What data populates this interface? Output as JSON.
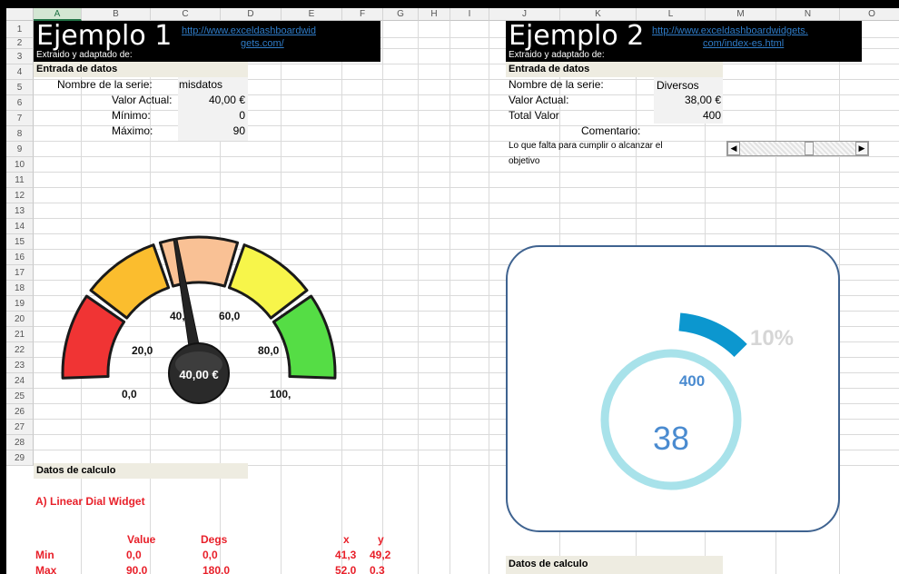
{
  "columns": [
    "A",
    "B",
    "C",
    "D",
    "E",
    "F",
    "G",
    "H",
    "I",
    "J",
    "K",
    "L",
    "M",
    "N",
    "O"
  ],
  "rows": [
    "1",
    "2",
    "3",
    "4",
    "5",
    "6",
    "7",
    "8",
    "9",
    "10",
    "11",
    "12",
    "13",
    "14",
    "15",
    "16",
    "17",
    "18",
    "19",
    "20",
    "21",
    "22",
    "23",
    "24",
    "25",
    "26",
    "27",
    "28",
    "29"
  ],
  "selected_column": "A",
  "example1": {
    "title": "Ejemplo 1",
    "link_line1": "http://www.exceldashboardwid",
    "link_line2": "gets.com/",
    "extracted": "Extraido y adaptado de:",
    "input_header": "Entrada de datos",
    "series_label": "Nombre de la serie:",
    "series_value": "misdatos",
    "actual_label": "Valor Actual:",
    "actual_value": "40,00 €",
    "min_label": "Mínimo:",
    "min_value": "0",
    "max_label": "Máximo:",
    "max_value": "90",
    "calc_header": "Datos de calculo",
    "widget_title": "A) Linear Dial Widget",
    "table_headers": {
      "value": "Value",
      "degs": "Degs",
      "x": "x",
      "y": "y"
    },
    "table_rows": [
      {
        "label": "Min",
        "value": "0,0",
        "degs": "0,0",
        "x": "41,3",
        "y": "49,2"
      },
      {
        "label": "Max",
        "value": "90,0",
        "degs": "180,0",
        "x": "52,0",
        "y": "0,3"
      }
    ],
    "gauge": {
      "labels": [
        "0,0",
        "20,0",
        "40,",
        "60,0",
        "80,0",
        "100,"
      ],
      "center_label": "40,00 €",
      "value": 40,
      "min": 0,
      "max": 90,
      "segment_colors": [
        "#f03434",
        "#fbbd2e",
        "#f9c195",
        "#f7f54a",
        "#55dd45"
      ]
    }
  },
  "example2": {
    "title": "Ejemplo 2",
    "link_line1": "http://www.exceldashboardwidgets.",
    "link_line2": "com/index-es.html",
    "extracted": "Extraido y adaptado de:",
    "input_header": "Entrada de datos",
    "series_label": "Nombre de la serie:",
    "series_value": "Diversos",
    "actual_label": "Valor Actual:",
    "actual_value": "38,00 €",
    "total_label": "Total Valor",
    "total_value": "400",
    "comment_label": "Comentario:",
    "comment_line1": "Lo que falta para cumplir o alcanzar el",
    "comment_line2": "objetivo",
    "calc_header": "Datos de calculo",
    "scrollbar_value": 38,
    "scrollbar_max": 400,
    "donut": {
      "percent_label": "10%",
      "total_label": "400",
      "value_label": "38",
      "arc_color": "#0c97cf",
      "ring_color": "#a8e2ea",
      "frame_color": "#3f6390"
    }
  }
}
